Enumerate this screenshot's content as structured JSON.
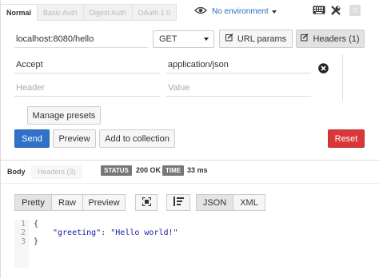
{
  "auth_tabs": [
    "Normal",
    "Basic Auth",
    "Digest Auth",
    "OAuth 1.0"
  ],
  "environment": {
    "label": "No environment"
  },
  "toolbar": {
    "badge": "0"
  },
  "request": {
    "url": "localhost:8080/hello",
    "method": "GET",
    "url_params_label": "URL params",
    "headers_label": "Headers (1)"
  },
  "headers_editor": {
    "rows": [
      {
        "key": "Accept",
        "value": "application/json"
      }
    ],
    "key_placeholder": "Header",
    "value_placeholder": "Value",
    "manage_presets_label": "Manage presets"
  },
  "actions": {
    "send": "Send",
    "preview": "Preview",
    "add_to_collection": "Add to collection",
    "reset": "Reset"
  },
  "response": {
    "tabs": [
      "Body",
      "Headers (3)"
    ],
    "status_label": "STATUS",
    "status_value": "200 OK",
    "time_label": "TIME",
    "time_value": "33 ms",
    "view_modes": [
      "Pretty",
      "Raw",
      "Preview"
    ],
    "formats": [
      "JSON",
      "XML"
    ],
    "body": {
      "line_numbers": [
        "1",
        "2",
        "3"
      ],
      "open_brace": "{",
      "key": "\"greeting\"",
      "colon": ": ",
      "value": "\"Hello world!\"",
      "close_brace": "}"
    }
  },
  "colors": {
    "send": "#2f72c8",
    "reset": "#d9383a",
    "link": "#2a6dbd"
  }
}
